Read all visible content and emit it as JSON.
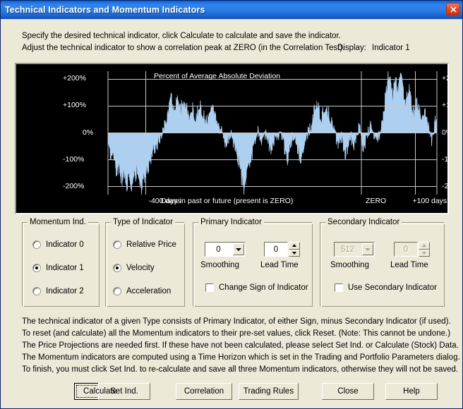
{
  "window": {
    "title": "Technical Indicators and Momentum Indicators",
    "close_icon": "close-x-icon"
  },
  "header": {
    "line1": "Specify the desired technical indicator, click Calculate to calculate and save the indicator.",
    "line2": "Adjust the technical indicator to show a correlation peak at ZERO (in the Correlation Test).",
    "display_label": "Display:",
    "display_value": "Indicator 1"
  },
  "chart_data": {
    "type": "area",
    "title": "Percent of Average Absolute Deviation",
    "xlabel": "Days in past or future (present is ZERO)",
    "ylabel": "",
    "ylim": [
      -230,
      230
    ],
    "xlim": [
      -470,
      140
    ],
    "y_ticks": [
      "+200%",
      "+100%",
      "0%",
      "-100%",
      "-200%"
    ],
    "y_tick_values": [
      200,
      100,
      0,
      -100,
      -200
    ],
    "x_tick_labels": [
      "-400 days",
      "ZERO",
      "+100 days"
    ],
    "x_tick_values": [
      -400,
      0,
      100
    ],
    "grid": true,
    "baseline": 0,
    "fill_color": "#aed0f0",
    "background_color": "#000000",
    "axis_color": "#c8c8c8",
    "text_color": "#ffffff",
    "legend": "none",
    "series": [
      {
        "name": "Percent of Average Absolute Deviation",
        "x": [
          -470,
          -467,
          -464,
          -461,
          -458,
          -455,
          -452,
          -449,
          -446,
          -443,
          -440,
          -437,
          -434,
          -431,
          -428,
          -425,
          -422,
          -419,
          -416,
          -413,
          -410,
          -407,
          -404,
          -401,
          -398,
          -395,
          -392,
          -389,
          -386,
          -383,
          -380,
          -377,
          -374,
          -371,
          -368,
          -365,
          -362,
          -359,
          -356,
          -353,
          -350,
          -347,
          -344,
          -341,
          -338,
          -335,
          -332,
          -329,
          -326,
          -323,
          -320,
          -317,
          -314,
          -311,
          -308,
          -305,
          -302,
          -299,
          -296,
          -293,
          -290,
          -287,
          -284,
          -281,
          -278,
          -275,
          -272,
          -269,
          -266,
          -263,
          -260,
          -257,
          -254,
          -251,
          -248,
          -245,
          -242,
          -239,
          -236,
          -233,
          -230,
          -227,
          -224,
          -221,
          -218,
          -215,
          -212,
          -209,
          -206,
          -203,
          -200,
          -197,
          -194,
          -191,
          -188,
          -185,
          -182,
          -179,
          -176,
          -173,
          -170,
          -167,
          -164,
          -161,
          -158,
          -155,
          -152,
          -149,
          -146,
          -143,
          -140,
          -137,
          -134,
          -131,
          -128,
          -125,
          -122,
          -119,
          -116,
          -113,
          -110,
          -107,
          -104,
          -101,
          -98,
          -95,
          -92,
          -89,
          -86,
          -83,
          -80,
          -77,
          -74,
          -71,
          -68,
          -65,
          -62,
          -59,
          -56,
          -53,
          -50,
          -47,
          -44,
          -41,
          -38,
          -35,
          -32,
          -29,
          -26,
          -23,
          -20,
          -17,
          -14,
          -11,
          -8,
          -5,
          -2,
          1,
          4,
          7,
          10,
          13,
          16,
          19,
          22,
          25,
          28,
          31,
          34,
          37,
          40,
          43,
          46,
          49,
          52,
          55,
          58,
          61,
          64,
          67,
          70,
          73,
          76,
          79,
          82,
          85,
          88,
          91,
          94,
          97,
          100,
          103,
          106,
          109,
          112,
          115,
          118,
          121,
          124,
          127,
          130,
          133,
          136
        ],
        "values": [
          -60,
          -75,
          -95,
          -70,
          -110,
          -130,
          -150,
          -120,
          -165,
          -185,
          -140,
          -175,
          -200,
          -170,
          -210,
          -190,
          -160,
          -180,
          -145,
          -165,
          -195,
          -215,
          -175,
          -155,
          -135,
          -120,
          -100,
          -85,
          -70,
          -55,
          -45,
          -30,
          -20,
          -10,
          10,
          30,
          55,
          80,
          100,
          125,
          105,
          85,
          115,
          140,
          120,
          95,
          110,
          130,
          105,
          75,
          60,
          80,
          100,
          75,
          50,
          70,
          95,
          110,
          85,
          60,
          40,
          55,
          75,
          95,
          115,
          100,
          80,
          55,
          35,
          20,
          5,
          -10,
          -25,
          -40,
          -30,
          -15,
          0,
          -20,
          -45,
          -70,
          -95,
          -120,
          -145,
          -175,
          -205,
          -185,
          -160,
          -130,
          -100,
          -70,
          -45,
          -25,
          -10,
          5,
          -5,
          -20,
          -35,
          -15,
          0,
          -25,
          -50,
          -75,
          -60,
          -40,
          -20,
          -5,
          10,
          -10,
          -30,
          -55,
          -80,
          -100,
          -75,
          -50,
          -30,
          -15,
          -35,
          -60,
          -85,
          -105,
          -85,
          -60,
          -35,
          -15,
          0,
          20,
          45,
          70,
          95,
          120,
          100,
          75,
          50,
          70,
          90,
          110,
          85,
          60,
          40,
          20,
          0,
          -20,
          -45,
          -30,
          -10,
          -30,
          -55,
          -75,
          -55,
          -30,
          -10,
          -25,
          -45,
          -20,
          0,
          20,
          -10,
          -35,
          -60,
          -40,
          -15,
          5,
          25,
          45,
          10,
          -20,
          -50,
          -30,
          0,
          30,
          60,
          100,
          150,
          210,
          230,
          180,
          140,
          175,
          205,
          160,
          195,
          215,
          175,
          140,
          110,
          135,
          160,
          130,
          95,
          70,
          100,
          125,
          90,
          60,
          35,
          60,
          85,
          55,
          25,
          0,
          -20,
          10,
          40,
          25,
          -5,
          -30,
          -10,
          20,
          45,
          70,
          40,
          15,
          -10,
          15,
          45,
          75,
          105,
          130,
          110,
          80,
          50,
          20,
          -10,
          -40,
          -25,
          -50,
          -30,
          0,
          35,
          70,
          105,
          130,
          160,
          180,
          150
        ]
      }
    ]
  },
  "groups": {
    "momentum": {
      "title": "Momentum Ind.",
      "options": [
        {
          "label": "Indicator 0",
          "selected": false
        },
        {
          "label": "Indicator 1",
          "selected": true
        },
        {
          "label": "Indicator 2",
          "selected": false
        }
      ]
    },
    "type_of_indicator": {
      "title": "Type of Indicator",
      "options": [
        {
          "label": "Relative Price",
          "selected": false
        },
        {
          "label": "Velocity",
          "selected": true
        },
        {
          "label": "Acceleration",
          "selected": false
        }
      ]
    },
    "primary": {
      "title": "Primary Indicator",
      "smoothing_value": "0",
      "smoothing_caption": "Smoothing",
      "lead_time_value": "0",
      "lead_time_caption": "Lead Time",
      "checkbox_label": "Change Sign of Indicator",
      "checkbox_checked": false
    },
    "secondary": {
      "title": "Secondary Indicator",
      "smoothing_value": "512",
      "smoothing_caption": "Smoothing",
      "lead_time_value": "0",
      "lead_time_caption": "Lead Time",
      "checkbox_label": "Use Secondary Indicator",
      "checkbox_checked": false
    }
  },
  "help": {
    "line1": "The technical indicator of a given Type consists of Primary Indicator, of either Sign, minus Secondary Indicator (if used).",
    "line2": "To reset (and calculate) all the Momentum indicators to their pre-set values, click Reset.  (Note: This cannot be undone.)",
    "line3": "The Price Projections are needed first. If these have not been calculated, please select Set Ind. or Calculate (Stock) Data.",
    "line4": "The Momentum indicators are computed using a Time Horizon which is set in the Trading and Portfolio Parameters dialog.",
    "line5": "To finish, you must click Set Ind. to re-calculate and save all three Momentum indicators, otherwise they will not be saved."
  },
  "buttons": {
    "calculate": "Calculate",
    "set_ind": "Set Ind.",
    "correlation": "Correlation",
    "trading_rules": "Trading Rules",
    "close": "Close",
    "help": "Help"
  },
  "colors": {
    "titlebar_blue": "#2f85ec",
    "dialog_face": "#ece9d8",
    "chart_bg": "#000000",
    "chart_fill": "#aed0f0",
    "close_red": "#e04a26"
  }
}
